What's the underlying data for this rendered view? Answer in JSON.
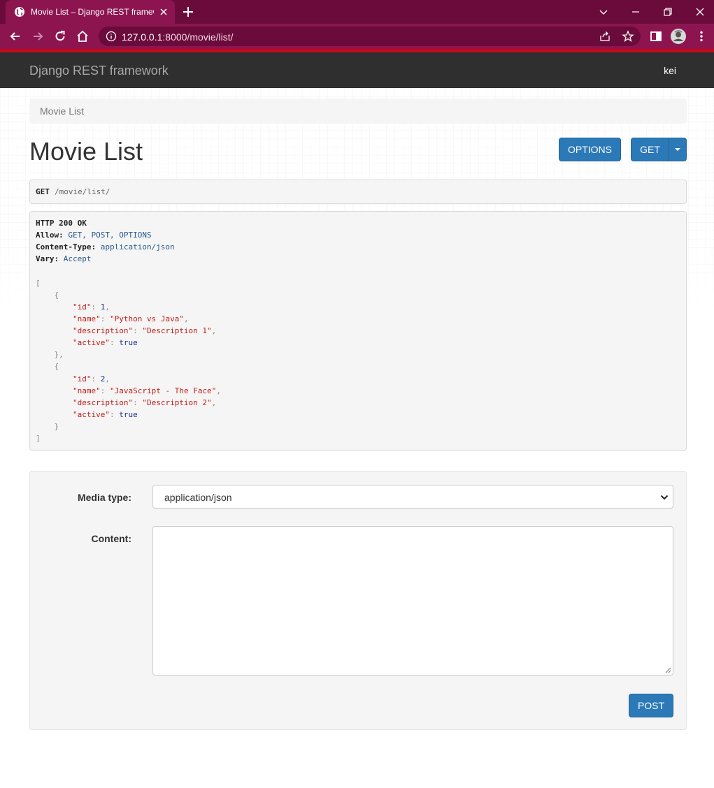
{
  "browser": {
    "tab_title": "Movie List – Django REST framework",
    "url_host": "127.0.0.1",
    "url_rest": ":8000/movie/list/"
  },
  "navbar": {
    "brand": "Django REST framework",
    "user": "kei"
  },
  "breadcrumb": {
    "current": "Movie List"
  },
  "page": {
    "title": "Movie List",
    "options_label": "OPTIONS",
    "get_label": "GET"
  },
  "request": {
    "method": "GET",
    "path": "/movie/list/"
  },
  "response": {
    "status": "HTTP 200 OK",
    "allow_key": "Allow:",
    "allow_value": "GET, POST, OPTIONS",
    "content_type_key": "Content-Type:",
    "content_type_value": "application/json",
    "vary_key": "Vary:",
    "vary_value": "Accept",
    "body": [
      {
        "id": 1,
        "name": "Python vs Java",
        "description": "Description 1",
        "active": "true"
      },
      {
        "id": 2,
        "name": "JavaScript - The Face",
        "description": "Description 2",
        "active": "true"
      }
    ]
  },
  "form": {
    "media_type_label": "Media type:",
    "media_type_value": "application/json",
    "content_label": "Content:",
    "content_value": "",
    "post_label": "POST"
  },
  "colors": {
    "tabstrip": "#6b0b3b",
    "toolbar": "#8c1550",
    "navbar": "#2f2f2f",
    "primary_button": "#2c79b8",
    "json_string": "#c41a16",
    "json_number": "#1c2f93"
  },
  "icons": [
    "globe-icon",
    "close-icon",
    "plus-icon",
    "chevron-down-icon",
    "minimize-icon",
    "restore-icon",
    "back-icon",
    "forward-icon",
    "reload-icon",
    "home-icon",
    "info-icon",
    "share-icon",
    "star-icon",
    "sidepanel-icon",
    "avatar",
    "menu-icon"
  ]
}
